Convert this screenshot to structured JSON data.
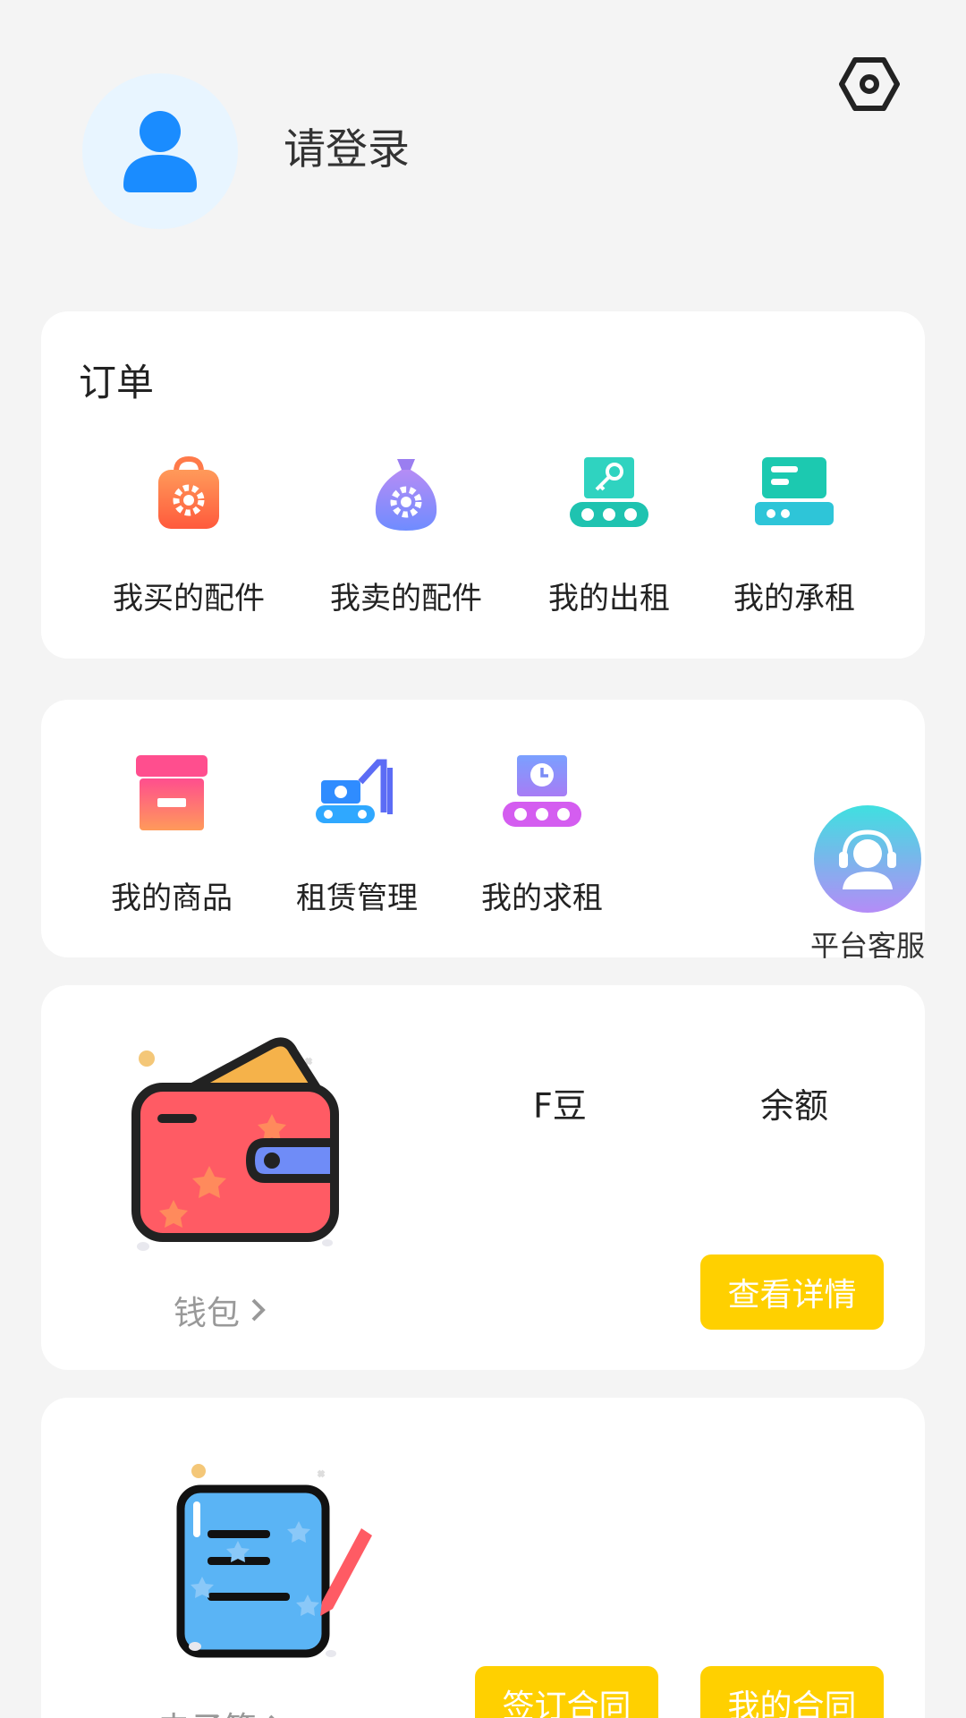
{
  "header": {
    "login_prompt": "请登录"
  },
  "orders": {
    "title": "订单",
    "items": [
      {
        "label": "我买的配件",
        "icon": "orange-bag-gear-icon"
      },
      {
        "label": "我卖的配件",
        "icon": "purple-sack-gear-icon"
      },
      {
        "label": "我的出租",
        "icon": "teal-conveyor-key-icon"
      },
      {
        "label": "我的承租",
        "icon": "teal-device-icon"
      }
    ]
  },
  "management": {
    "items": [
      {
        "label": "我的商品",
        "icon": "pink-box-icon"
      },
      {
        "label": "租赁管理",
        "icon": "blue-excavator-icon"
      },
      {
        "label": "我的求租",
        "icon": "purple-conveyor-clock-icon"
      }
    ]
  },
  "wallet": {
    "link_label": "钱包",
    "stats": [
      "F豆",
      "余额"
    ],
    "detail_button": "查看详情"
  },
  "contract": {
    "link_label": "电子签",
    "sign_button": "签订合同",
    "my_button": "我的合同"
  },
  "service": {
    "label": "平台客服"
  },
  "colors": {
    "accent_yellow": "#ffd000",
    "avatar_blue": "#1a8cff",
    "background": "#f4f4f4"
  }
}
